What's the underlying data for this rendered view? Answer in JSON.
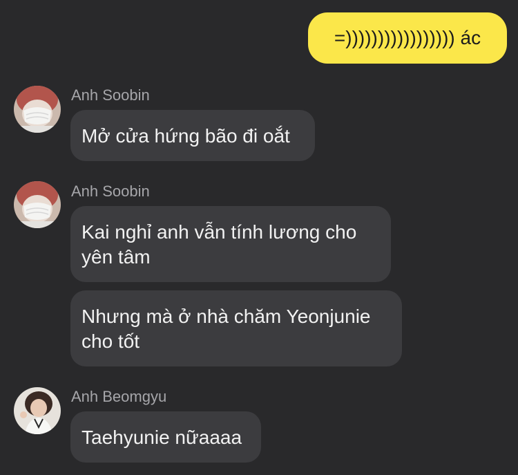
{
  "outgoing": {
    "text": "=))))))))))))))))) ác"
  },
  "groups": [
    {
      "sender": "Anh Soobin",
      "messages": [
        "Mở cửa hứng bão đi oắt"
      ]
    },
    {
      "sender": "Anh Soobin",
      "messages": [
        "Kai nghỉ anh vẫn tính lương cho yên tâm",
        "Nhưng mà ở nhà chăm Yeonjunie cho tốt"
      ]
    },
    {
      "sender": "Anh Beomgyu",
      "messages": [
        "Taehyunie nữaaaa"
      ]
    }
  ],
  "colors": {
    "background": "#29292b",
    "outgoing_bubble": "#fbe74a",
    "incoming_bubble": "#3c3c3f",
    "sender_name": "#a6a6aa"
  }
}
